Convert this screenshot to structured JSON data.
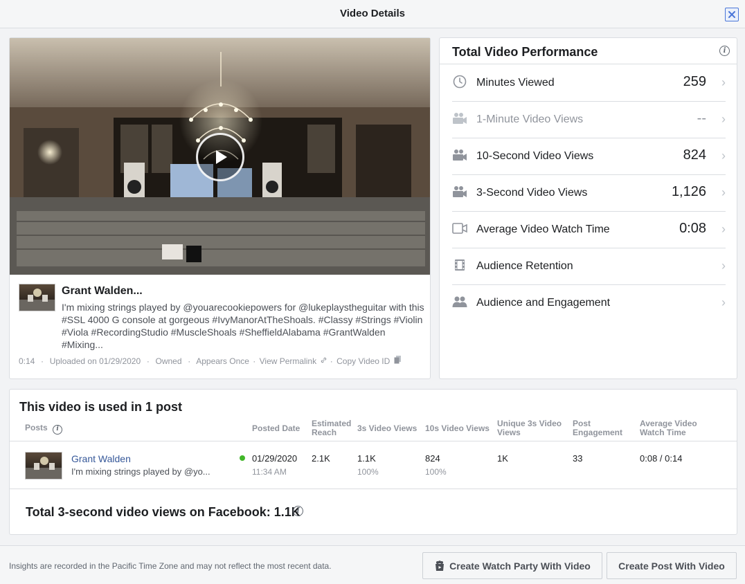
{
  "modal": {
    "title": "Video Details"
  },
  "video": {
    "post": {
      "author": "Grant Walden...",
      "caption": "I'm mixing strings played by @youarecookiepowers for @lukeplaystheguitar with this #SSL 4000 G console at gorgeous #IvyManorAtTheShoals. #Classy #Strings #Violin #Viola #RecordingStudio #MuscleShoals #SheffieldAlabama #GrantWalden #Mixing..."
    },
    "meta": {
      "duration": "0:14",
      "uploaded": "Uploaded on 01/29/2020",
      "owned": "Owned",
      "appears": "Appears Once",
      "permalink": "View Permalink",
      "copy_id": "Copy Video ID",
      "dot": "·"
    }
  },
  "performance": {
    "title": "Total Video Performance",
    "metrics": [
      {
        "label": "Minutes Viewed",
        "value": "259",
        "icon": "clock-icon"
      },
      {
        "label": "1-Minute Video Views",
        "value": "--",
        "icon": "video-camera-icon"
      },
      {
        "label": "10-Second Video Views",
        "value": "824",
        "icon": "video-camera-icon"
      },
      {
        "label": "3-Second Video Views",
        "value": "1,126",
        "icon": "video-camera-icon"
      },
      {
        "label": "Average Video Watch Time",
        "value": "0:08",
        "icon": "video-icon"
      },
      {
        "label": "Audience Retention",
        "value": "",
        "icon": "film-icon"
      },
      {
        "label": "Audience and Engagement",
        "value": "",
        "icon": "people-icon"
      }
    ],
    "chevron": "›"
  },
  "posts": {
    "title": "This video is used in 1 post",
    "headers": {
      "posts": "Posts",
      "posted_date": "Posted Date",
      "estimated_reach_1": "Estimated",
      "estimated_reach_2": "Reach",
      "views_3s": "3s Video Views",
      "views_10s": "10s Video Views",
      "unique_3s_1": "Unique 3s Video",
      "unique_3s_2": "Views",
      "engagement_1": "Post",
      "engagement_2": "Engagement",
      "avg_watch_1": "Average Video",
      "avg_watch_2": "Watch Time"
    },
    "rows": [
      {
        "name": "Grant Walden",
        "snippet": "I'm mixing strings played by @yo...",
        "date": "01/29/2020",
        "time": "11:34 AM",
        "reach": "2.1K",
        "views_3s": "1.1K",
        "views_3s_pct": "100%",
        "views_10s": "824",
        "views_10s_pct": "100%",
        "unique_3s": "1K",
        "engagement": "33",
        "avg_watch": "0:08 / 0:14"
      }
    ],
    "total": "Total 3-second video views on Facebook: 1.1K"
  },
  "footer": {
    "note": "Insights are recorded in the Pacific Time Zone and may not reflect the most recent data.",
    "watch_party_button": "Create Watch Party With Video",
    "create_post_button": "Create Post With Video"
  },
  "colors": {
    "link": "#365899",
    "status_active": "#42b72a",
    "close_border": "#4a76d8"
  }
}
